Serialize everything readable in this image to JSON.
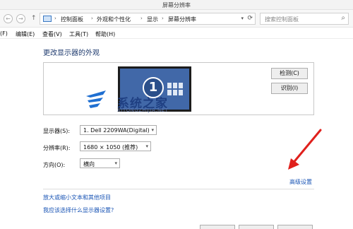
{
  "window": {
    "title": "屏幕分辨率"
  },
  "address": {
    "crumbs": [
      "控制面板",
      "外观和个性化",
      "显示",
      "屏幕分辨率"
    ]
  },
  "search": {
    "placeholder": "搜索控制面板"
  },
  "menu": [
    "(F)",
    "编辑(E)",
    "查看(V)",
    "工具(T)",
    "帮助(H)"
  ],
  "main": {
    "heading": "更改显示器的外观",
    "monitor_number": "1",
    "detect_label": "检测(C)",
    "identify_label": "识别(I)"
  },
  "watermark": {
    "text": "系统之家",
    "sub": "XITONGZHIJIA.NET"
  },
  "settings": {
    "display_label": "显示器(S):",
    "display_value": "1. Dell 2209WA(Digital)",
    "resolution_label": "分辨率(R):",
    "resolution_value": "1680 × 1050 (推荐)",
    "orientation_label": "方向(O):",
    "orientation_value": "横向"
  },
  "links": {
    "advanced": "高级设置",
    "enlarge_text": "放大或缩小文本和其他项目",
    "which_settings": "我应该选择什么显示器设置?"
  },
  "colors": {
    "accent": "#1a55b5",
    "monitor": "#4168a8",
    "arrow": "#e0201c"
  }
}
